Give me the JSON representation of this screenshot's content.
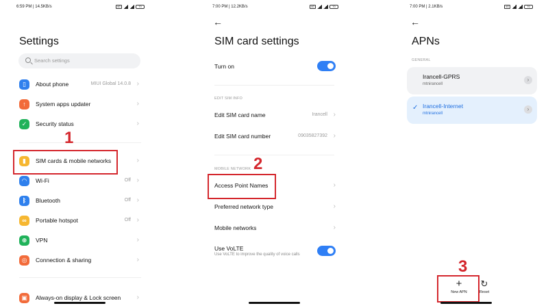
{
  "panel1": {
    "status": {
      "time_speed": "6:59 PM | 14.5KB/s",
      "battery": "70"
    },
    "title": "Settings",
    "search_placeholder": "Search settings",
    "items": [
      {
        "label": "About phone",
        "value": "MIUI Global 14.0.8",
        "icon": "phone-icon",
        "color": "#2f80ed"
      },
      {
        "label": "System apps updater",
        "value": "",
        "icon": "arrow-up-icon",
        "color": "#f26b3a"
      },
      {
        "label": "Security status",
        "value": "",
        "icon": "shield-check-icon",
        "color": "#20b25a"
      },
      {
        "label": "SIM cards & mobile networks",
        "value": "",
        "icon": "sim-icon",
        "color": "#f6b731"
      },
      {
        "label": "Wi-Fi",
        "value": "Off",
        "icon": "wifi-icon",
        "color": "#2f80ed"
      },
      {
        "label": "Bluetooth",
        "value": "Off",
        "icon": "bluetooth-icon",
        "color": "#2f80ed"
      },
      {
        "label": "Portable hotspot",
        "value": "Off",
        "icon": "hotspot-icon",
        "color": "#f6b731"
      },
      {
        "label": "VPN",
        "value": "",
        "icon": "vpn-icon",
        "color": "#20b25a"
      },
      {
        "label": "Connection & sharing",
        "value": "",
        "icon": "connection-icon",
        "color": "#f26b3a"
      },
      {
        "label": "Always-on display & Lock screen",
        "value": "",
        "icon": "lock-icon",
        "color": "#f26b3a"
      }
    ],
    "annotation": "1"
  },
  "panel2": {
    "status": {
      "time_speed": "7:00 PM | 12.2KB/s",
      "battery": "70"
    },
    "title": "SIM card settings",
    "turn_on": "Turn on",
    "section_edit": "EDIT SIM INFO",
    "edit_name": "Edit SIM card name",
    "edit_name_value": "Irancell",
    "edit_number": "Edit SIM card number",
    "edit_number_value": "09035827392",
    "section_mobile": "MOBILE NETWORK",
    "apn": "Access Point Names",
    "preferred": "Preferred network type",
    "mobile_networks": "Mobile networks",
    "volte": "Use VoLTE",
    "volte_sub": "Use VoLTE to improve the quality of voice calls",
    "annotation": "2"
  },
  "panel3": {
    "status": {
      "time_speed": "7:00 PM | 2.1KB/s",
      "battery": "70"
    },
    "title": "APNs",
    "section_general": "GENERAL",
    "apns": [
      {
        "name": "Irancell-GPRS",
        "sub": "mtnirancell",
        "selected": false
      },
      {
        "name": "Irancell-Internet",
        "sub": "mtnirancell",
        "selected": true
      }
    ],
    "new_apn": "New APN",
    "reset": "Reset",
    "annotation": "3"
  },
  "colors": {
    "accent": "#2f7ff5",
    "annotation": "#d4262c"
  }
}
